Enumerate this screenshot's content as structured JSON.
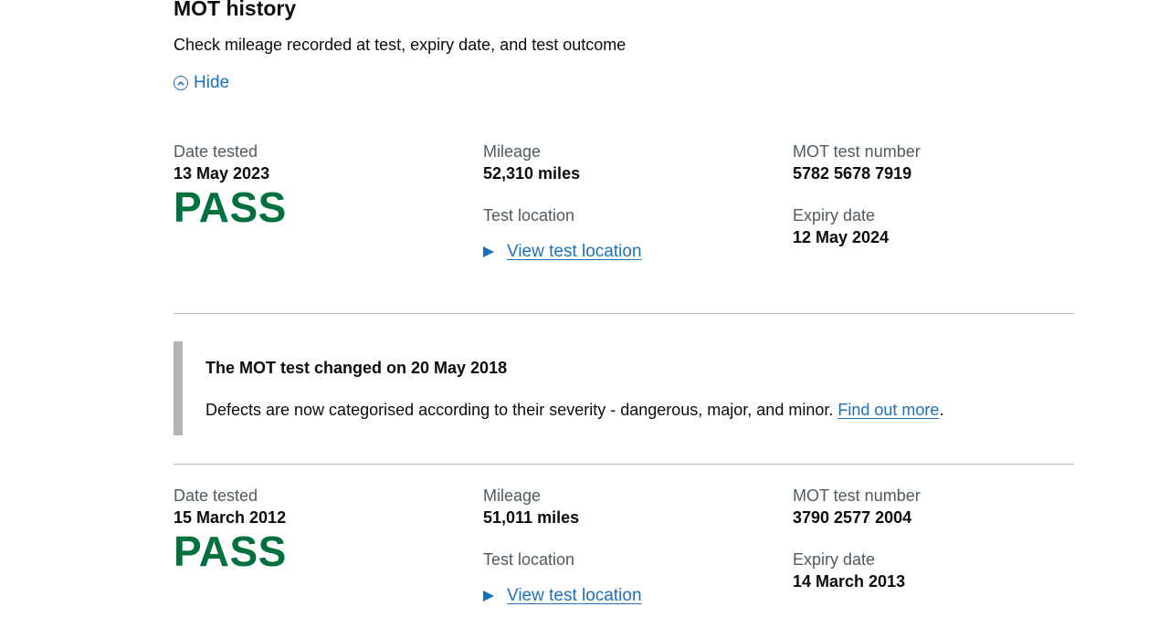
{
  "section": {
    "title": "MOT history",
    "subtitle": "Check mileage recorded at test, expiry date, and test outcome",
    "toggle_label": "Hide",
    "toggle_icon": "chevron-up-circle-icon"
  },
  "labels": {
    "date_tested": "Date tested",
    "mileage": "Mileage",
    "test_number": "MOT test number",
    "test_location": "Test location",
    "view_location": "View test location",
    "expiry_date": "Expiry date"
  },
  "records": [
    {
      "date_tested": "13 May 2023",
      "result": "PASS",
      "mileage": "52,310 miles",
      "test_number": "5782 5678 7919",
      "expiry_date": "12 May 2024"
    },
    {
      "date_tested": "15 March 2012",
      "result": "PASS",
      "mileage": "51,011 miles",
      "test_number": "3790 2577 2004",
      "expiry_date": "14 March 2013"
    }
  ],
  "notice": {
    "title": "The MOT test changed on 20 May 2018",
    "body": "Defects are now categorised according to their severity - dangerous, major, and minor.",
    "link_text": "Find out more",
    "trailing": "."
  },
  "colors": {
    "pass": "#00703c",
    "link": "#1d70b8",
    "inset_border": "#b1b4b6"
  }
}
